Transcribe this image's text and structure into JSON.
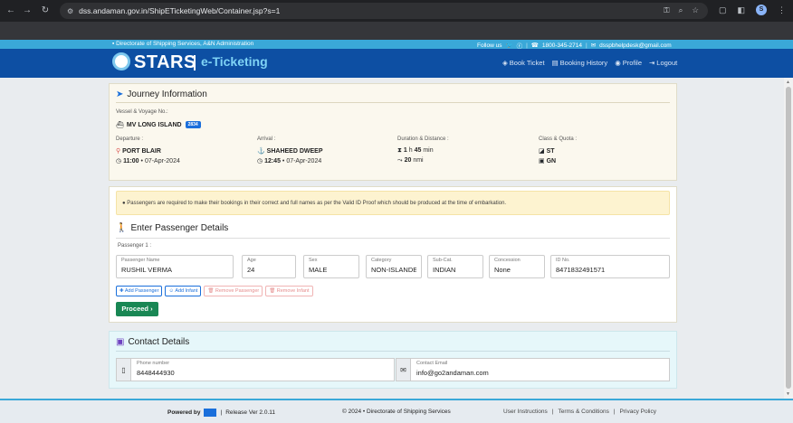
{
  "browser": {
    "url": "dss.andaman.gov.in/ShipETicketingWeb/Container.jsp?s=1",
    "profile_initial": "S"
  },
  "topbar": {
    "department": "Directorate of Shipping Services, A&N Administration",
    "follow_us": "Follow us",
    "phone": "1800-345-2714",
    "email": "dsspbhelpdesk@gmail.com"
  },
  "header": {
    "logo_main": "STARS",
    "logo_sub": "e-Ticketing",
    "nav": [
      {
        "label": "Book Ticket",
        "icon": "ticket-icon"
      },
      {
        "label": "Booking History",
        "icon": "history-icon"
      },
      {
        "label": "Profile",
        "icon": "user-icon"
      },
      {
        "label": "Logout",
        "icon": "logout-icon"
      }
    ]
  },
  "journey": {
    "title": "Journey Information",
    "vessel_label": "Vessel & Voyage No.:",
    "vessel_name": "MV LONG ISLAND",
    "voyage_no": "2834",
    "departure_label": "Departure :",
    "departure_port": "PORT BLAIR",
    "departure_time": "11:00",
    "departure_date": "• 07-Apr-2024",
    "arrival_label": "Arrival :",
    "arrival_port": "SHAHEED DWEEP",
    "arrival_time": "12:45",
    "arrival_date": "• 07-Apr-2024",
    "duration_label": "Duration & Distance :",
    "duration_h": "1",
    "duration_h_unit": "h",
    "duration_m": "45",
    "duration_m_unit": "min",
    "distance": "20",
    "distance_unit": "nmi",
    "class_label": "Class & Quota :",
    "class": "ST",
    "quota": "GN"
  },
  "passengers": {
    "notice": "Passengers are required to make their bookings in their correct and full names as per the Valid ID Proof which should be produced at the time of embarkation.",
    "title": "Enter Passenger Details",
    "passenger_label": "Passenger 1 :",
    "fields": {
      "name_label": "Passenger Name",
      "name_value": "RUSHIL VERMA",
      "age_label": "Age",
      "age_value": "24",
      "sex_label": "Sex",
      "sex_value": "MALE",
      "category_label": "Category",
      "category_value": "NON-ISLANDER",
      "subcat_label": "Sub-Cat.",
      "subcat_value": "INDIAN",
      "concession_label": "Concession",
      "concession_value": "None",
      "id_label": "ID No.",
      "id_value": "8471832491571"
    },
    "buttons": {
      "add_passenger": "Add Passenger",
      "add_infant": "Add Infant",
      "remove_passenger": "Remove Passenger",
      "remove_infant": "Remove Infant",
      "proceed": "Proceed"
    }
  },
  "contact": {
    "title": "Contact Details",
    "phone_label": "Phone number",
    "phone_value": "8448444930",
    "email_label": "Contact Email",
    "email_value": "info@go2andaman.com"
  },
  "footer": {
    "powered_by": "Powered by",
    "release": "Release Ver 2.0.11",
    "copyright": "© 2024 • Directorate of Shipping Services",
    "links": [
      "User Instructions",
      "Terms & Conditions",
      "Privacy Policy"
    ]
  },
  "colors": {
    "header_bg": "#0d4fa3",
    "topstrip_bg": "#3aa8d8",
    "proceed_bg": "#198754",
    "notice_bg": "#fdf3d0"
  }
}
